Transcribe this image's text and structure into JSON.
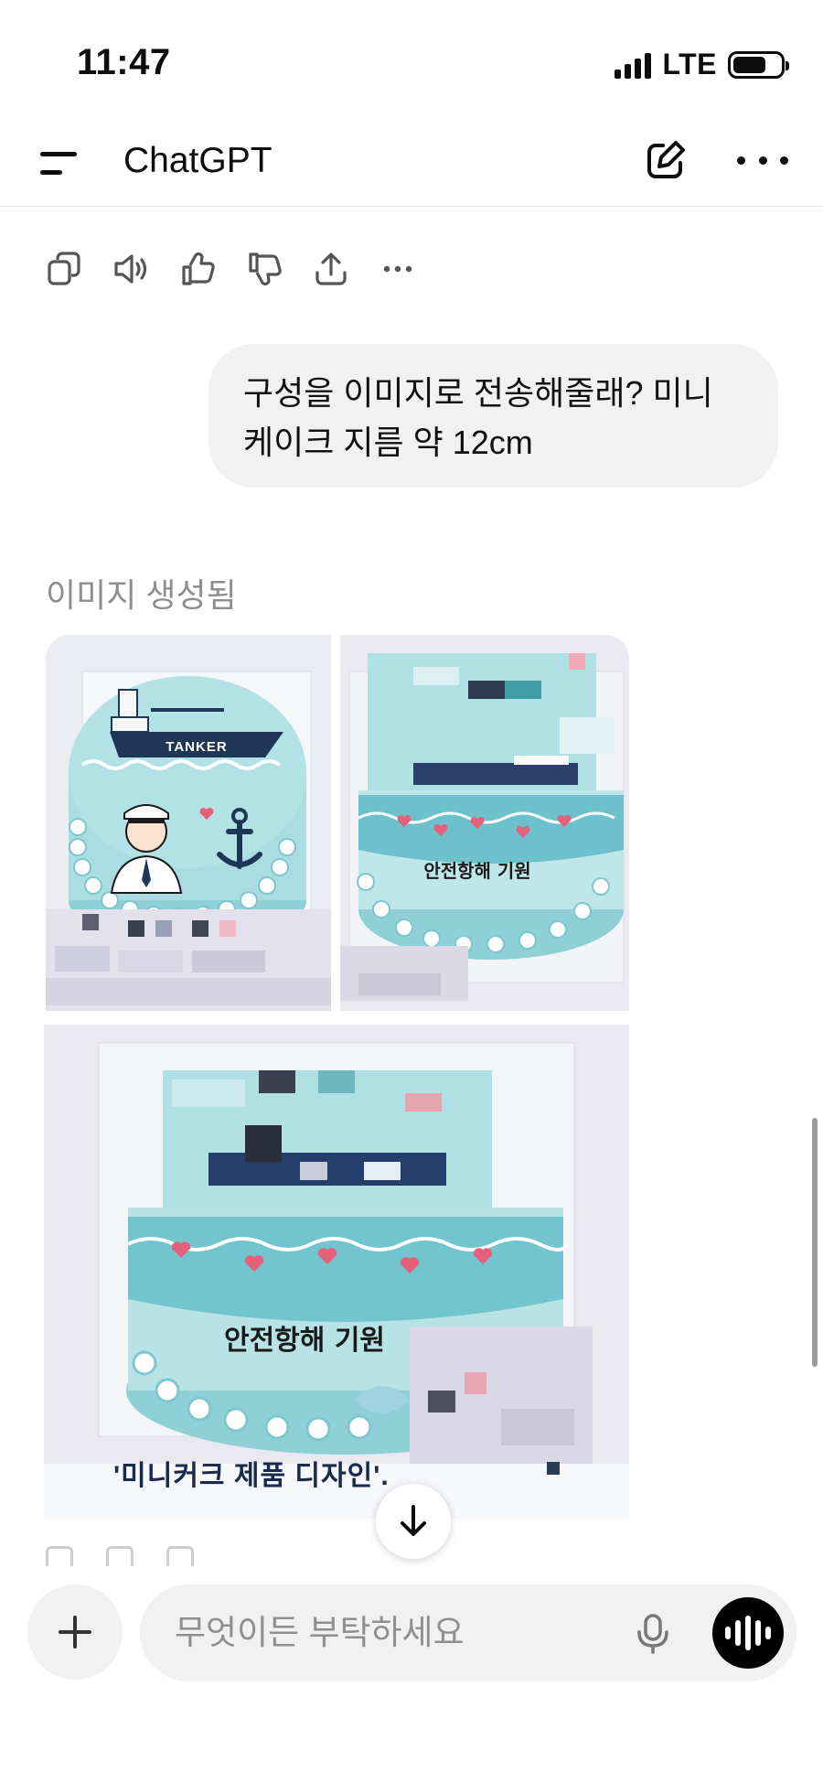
{
  "status_bar": {
    "time": "11:47",
    "network": "LTE",
    "battery_level": 0.7
  },
  "header": {
    "title": "ChatGPT"
  },
  "user_message": {
    "text": "구성을 이미지로 전송해줄래? 미니 케이크 지름 약 12cm"
  },
  "assistant": {
    "generated_label": "이미지 생성됨",
    "cake_topper_text": "TANKER",
    "cake_message_small": "안전항해 기원",
    "cake_message_large": "안전항해 기원",
    "caption": "'미니커크 제품 디자인'."
  },
  "composer": {
    "placeholder": "무엇이든 부탁하세요",
    "value": ""
  },
  "colors": {
    "cake_blue": "#a9dde2",
    "navy": "#1f3656",
    "bubble_bg": "#f1f1f1",
    "muted": "#8e8e8e"
  },
  "icons": {
    "actions": [
      "copy-icon",
      "speaker-icon",
      "thumbs-up-icon",
      "thumbs-down-icon",
      "share-icon",
      "more-icon"
    ],
    "header": [
      "menu-icon",
      "new-chat-icon",
      "more-icon"
    ],
    "composer": [
      "plus-icon",
      "microphone-icon",
      "voice-waveform-icon"
    ]
  }
}
